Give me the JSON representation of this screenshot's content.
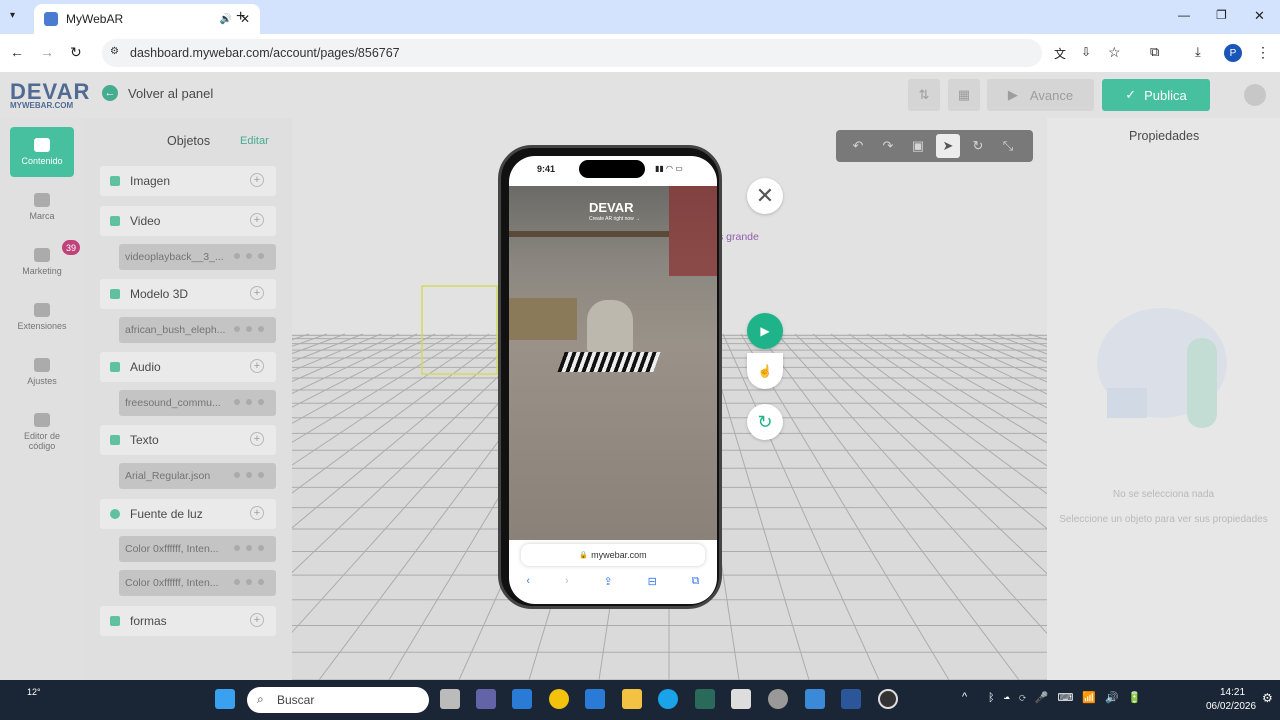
{
  "browser": {
    "tab_title": "MyWebAR",
    "url": "dashboard.mywebar.com/account/pages/856767",
    "profile_initial": "P"
  },
  "app": {
    "logo": "DEVAR",
    "logo_sub": "MYWEBAR.COM",
    "back_label": "Volver al panel",
    "preview_label": "Avance",
    "publish_label": "Publica"
  },
  "nav": {
    "items": [
      {
        "label": "Contenido"
      },
      {
        "label": "Marca"
      },
      {
        "label": "Marketing"
      },
      {
        "label": "Extensiones"
      },
      {
        "label": "Ajustes"
      },
      {
        "label": "Editor de código"
      }
    ],
    "extensions_badge": "39"
  },
  "objects": {
    "title": "Objetos",
    "edit_label": "Editar",
    "groups": [
      {
        "label": "Imagen"
      },
      {
        "label": "Video",
        "items": [
          "videoplayback__3_..."
        ]
      },
      {
        "label": "Modelo 3D",
        "items": [
          "african_bush_eleph..."
        ]
      },
      {
        "label": "Audio",
        "items": [
          "freesound_commu..."
        ]
      },
      {
        "label": "Texto",
        "items": [
          "Arial_Regular.json"
        ]
      },
      {
        "label": "Fuente de luz",
        "items": [
          "Color 0xffffff, Inten...",
          "Color 0xffffff, Inten..."
        ]
      },
      {
        "label": "formas"
      }
    ]
  },
  "properties": {
    "title": "Propiedades",
    "empty_title": "No se selecciona nada",
    "empty_hint": "Seleccione un objeto para ver sus propiedades"
  },
  "scene": {
    "partial_text": "s grande"
  },
  "phone": {
    "time": "9:41",
    "brand": "DEVAR",
    "tagline": "Create AR right now →",
    "browser_url": "mywebar.com"
  },
  "taskbar": {
    "weather": "12°",
    "search_placeholder": "Buscar",
    "time": "14:21",
    "date": "06/02/2026"
  }
}
